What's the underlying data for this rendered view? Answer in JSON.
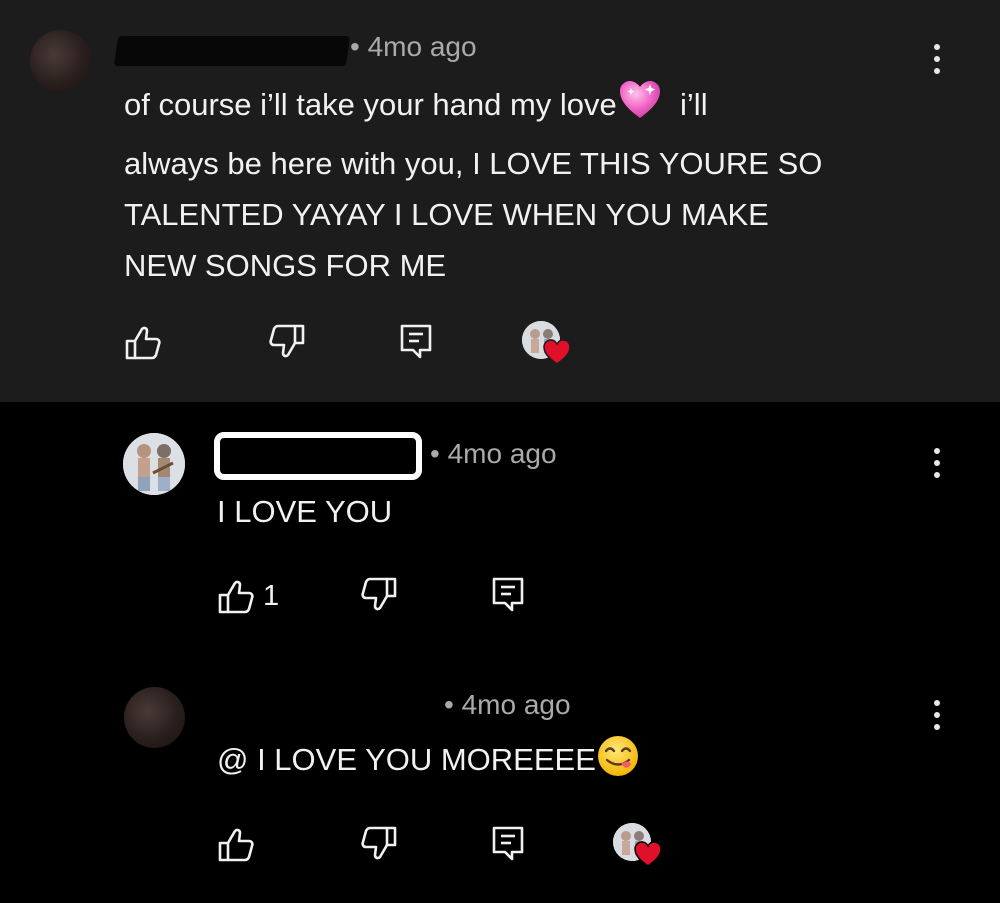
{
  "comments": [
    {
      "time": "4mo ago",
      "separator": "•",
      "line1": "of course i’ll take your hand my love",
      "line1_after": "i’ll",
      "line2": "always be here with you, I LOVE THIS YOURE SO",
      "line3": "TALENTED YAYAY I LOVE WHEN YOU MAKE",
      "line4": "NEW SONGS FOR ME",
      "emoji": "pink-heart"
    },
    {
      "time": "4mo ago",
      "separator": "•",
      "text": "I LOVE YOU",
      "like_count": "1"
    },
    {
      "time": "4mo ago",
      "separator": "•",
      "text": "@ I LOVE YOU MOREEEE",
      "emoji": "yum-face"
    }
  ],
  "icons": {
    "like": "thumbs-up-icon",
    "dislike": "thumbs-down-icon",
    "reply": "reply-icon",
    "more": "more-vertical-icon",
    "creator_heart": "heart-icon"
  },
  "colors": {
    "top_panel_bg": "#1c1c1c",
    "page_bg": "#000000",
    "text": "#f1f1f1",
    "meta": "#aaaaaa",
    "heart": "#e0102a"
  }
}
